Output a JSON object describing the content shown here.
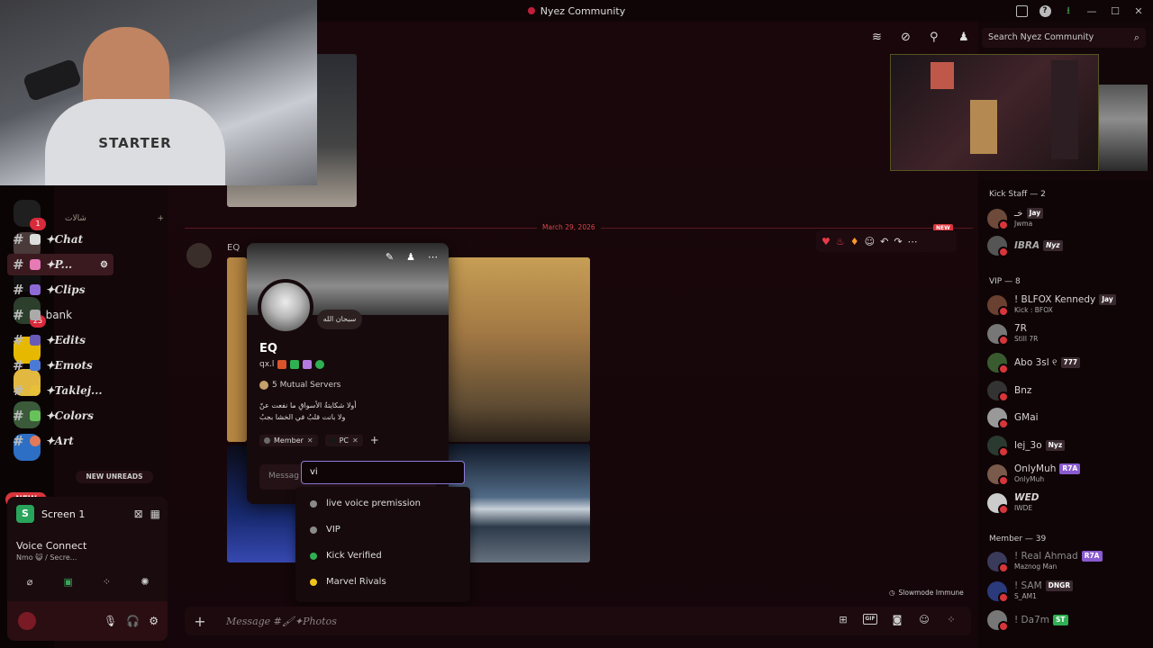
{
  "window": {
    "title": "Nyez Community"
  },
  "search": {
    "placeholder": "Search Nyez Community"
  },
  "channels": {
    "category": "شالات",
    "items": [
      {
        "label": "✦Chat"
      },
      {
        "label": "✦P..."
      },
      {
        "label": "✦Clips"
      },
      {
        "label": "bank"
      },
      {
        "label": "✦Edits"
      },
      {
        "label": "✦Emots"
      },
      {
        "label": "✦Taklej..."
      },
      {
        "label": "✦Colors"
      },
      {
        "label": "✦Art"
      }
    ],
    "new_unreads": "NEW UNREADS",
    "new_pill": "NEW",
    "badges": {
      "server1": "1",
      "server2": "25"
    }
  },
  "panel": {
    "screen_label": "Screen 1",
    "voice_title": "Voice Connect",
    "voice_sub": "Nmo 😺 / Secre..."
  },
  "chat": {
    "date": "March 29, 2026",
    "new_tag": "NEW",
    "author": "EQ",
    "slowmode": "Slowmode Immune",
    "composer_placeholder": "Message #🖌✦Photos"
  },
  "profile": {
    "status": "سبحان الله",
    "name": "EQ",
    "handle": "qx.l",
    "mutual": "5 Mutual Servers",
    "bio_line1": "أولا شكايتةُ الأسواقِ ما نفعت عنّ",
    "bio_line2": "ولا بانت قلبُ في الخشا بجبُ",
    "roles": [
      {
        "name": "Member",
        "color": "#6a6a6a"
      },
      {
        "name": "PC",
        "color": "#171717"
      }
    ],
    "message_placeholder": "Messag"
  },
  "role_picker": {
    "query": "vi",
    "options": [
      {
        "label": "live voice premission",
        "color": "#8a8a8a"
      },
      {
        "label": "VIP",
        "color": "#8a8a8a"
      },
      {
        "label": "Kick Verified",
        "color": "#2fb052"
      },
      {
        "label": "Marvel Rivals",
        "color": "#f0c419"
      }
    ]
  },
  "members": {
    "groups": [
      {
        "header": "Kick Staff — 2",
        "members": [
          {
            "name": "خـ",
            "tag": "Jay",
            "sub": "Jwma",
            "color": "#6d4a3a"
          },
          {
            "name": "IBRA",
            "tag": "Nyz",
            "sub": "",
            "color": "#555"
          }
        ]
      },
      {
        "header": "VIP — 8",
        "members": [
          {
            "name": "! BLFOX Kennedy",
            "tag": "Jay",
            "sub": "Kick : BFOX",
            "color": "#6a4030"
          },
          {
            "name": "7R",
            "tag": "",
            "sub": "Still 7R",
            "color": "#777"
          },
          {
            "name": "Abo 3sl ୧",
            "tag": "777",
            "sub": "",
            "color": "#3a5a30"
          },
          {
            "name": "Bnz",
            "tag": "",
            "sub": "",
            "color": "#333"
          },
          {
            "name": "GMai",
            "tag": "",
            "sub": "",
            "color": "#999"
          },
          {
            "name": "lej_3o",
            "tag": "Nyz",
            "sub": "",
            "color": "#2a3a30"
          },
          {
            "name": "OnlyMuh",
            "tag": "R7A",
            "sub": "OnlyMuh",
            "color": "#7a5a4a"
          },
          {
            "name": "WED",
            "tag": "",
            "sub": "IWDE",
            "color": "#ccc"
          }
        ]
      },
      {
        "header": "Member — 39",
        "members": [
          {
            "name": "! Real Ahmad",
            "tag": "R7A",
            "sub": "Maznog Man",
            "color": "#3a3a5a"
          },
          {
            "name": "! SAM",
            "tag": "DNGR",
            "sub": "S_AM1",
            "color": "#2a3a7a"
          },
          {
            "name": "! Da7m",
            "tag": "ST",
            "sub": "",
            "color": "#777"
          }
        ]
      }
    ]
  },
  "colors": {
    "accent": "#d8353b",
    "brand_red": "#c21f3a",
    "online": "#2fb052",
    "focus": "#8e7ad6"
  },
  "icons": [
    "inbox-icon",
    "help-icon",
    "download-icon",
    "threads-icon",
    "mute-icon",
    "pin-icon",
    "members-icon",
    "search-icon",
    "gift-icon",
    "gif-icon",
    "sticker-icon",
    "emoji-icon",
    "apps-icon"
  ]
}
